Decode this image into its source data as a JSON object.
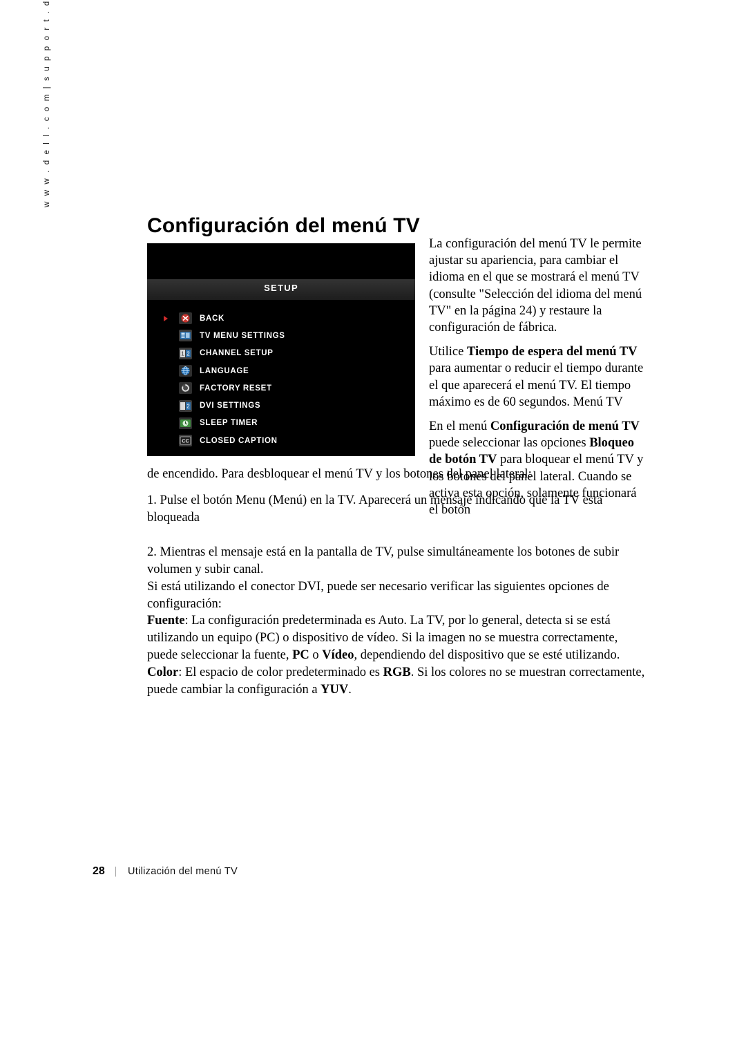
{
  "side_url": "w w w . d e l l . c o m  |  s u p p o r t . d e l l . c o m",
  "title": "Configuración del menú TV",
  "osd": {
    "header": "SETUP",
    "accent_color": "#cf2b2b",
    "background": "#000000",
    "items": [
      {
        "label": "BACK",
        "icon": "back-icon",
        "selected": true
      },
      {
        "label": "TV MENU SETTINGS",
        "icon": "tv-menu-settings-icon",
        "selected": false
      },
      {
        "label": "CHANNEL SETUP",
        "icon": "channel-setup-icon",
        "selected": false
      },
      {
        "label": "LANGUAGE",
        "icon": "language-globe-icon",
        "selected": false
      },
      {
        "label": "FACTORY RESET",
        "icon": "factory-reset-icon",
        "selected": false
      },
      {
        "label": "DVI SETTINGS",
        "icon": "dvi-settings-icon",
        "selected": false
      },
      {
        "label": "SLEEP TIMER",
        "icon": "sleep-timer-icon",
        "selected": false
      },
      {
        "label": "CLOSED CAPTION",
        "icon": "closed-caption-icon",
        "selected": false
      }
    ]
  },
  "right_column": {
    "para1": "La configuración del menú TV le permite ajustar su apariencia, para cambiar el idioma en el que se mostrará el menú TV (consulte \"Selección del idioma del menú TV\" en la página 24) y restaure la configuración de fábrica.",
    "para2_prefix": "Utilice ",
    "para2_bold": "Tiempo de espera del menú TV",
    "para2_rest": " para aumentar o reducir el tiempo durante el que aparecerá el menú TV. El tiempo máximo es de 60 segundos. Menú TV",
    "para3_prefix": "En el menú ",
    "para3_bold1": "Configuración de menú TV",
    "para3_mid": " puede seleccionar las opciones ",
    "para3_bold2": "Bloqueo de botón TV",
    "para3_rest": " para bloquear el menú TV y los botones del panel lateral. Cuando se activa esta opción, solamente funcionará el botón"
  },
  "body": {
    "para_cont": "de encendido. Para desbloquear el menú TV y los botones del panel lateral:",
    "step1": "1. Pulse el botón Menu (Menú) en la TV. Aparecerá un mensaje indicando que la TV está bloqueada",
    "step2": "2. Mientras el mensaje está en la pantalla de TV, pulse simultáneamente los botones de subir volumen y subir canal.",
    "para_dvi": "Si está utilizando el conector DVI, puede ser necesario verificar las siguientes opciones de configuración:",
    "fuente_bold": "Fuente",
    "fuente_text": ": La configuración predeterminada es Auto. La TV, por lo general, detecta si se está utilizando un equipo (PC) o dispositivo de vídeo. Si la imagen no se muestra correctamente, puede seleccionar la fuente, ",
    "fuente_bold2": "PC",
    "fuente_mid": " o ",
    "fuente_bold3": "Vídeo",
    "fuente_end": ", dependiendo del dispositivo que se esté utilizando.",
    "color_bold": "Color",
    "color_text": ": El espacio de color predeterminado es ",
    "color_bold2": "RGB",
    "color_mid": ". Si los colores no se muestran correctamente, puede cambiar la configuración a ",
    "color_bold3": "YUV",
    "color_end": "."
  },
  "footer": {
    "page_number": "28",
    "separator": "|",
    "section": "Utilización del menú TV"
  }
}
